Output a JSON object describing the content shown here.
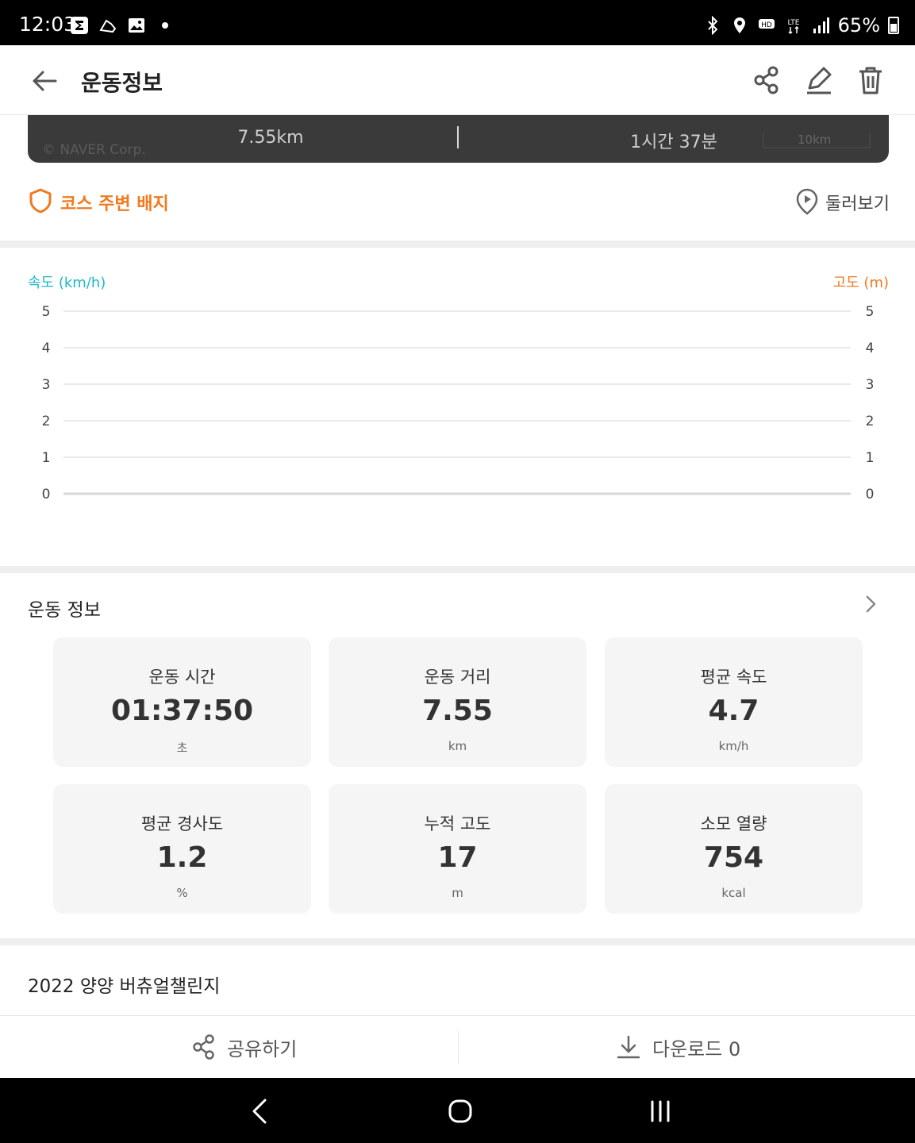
{
  "status_bar": {
    "time": "12:03",
    "battery": "65%"
  },
  "app_bar": {
    "title": "운동정보"
  },
  "map": {
    "credit": "© NAVER Corp.",
    "distance": "7.55km",
    "duration": "1시간 37분",
    "scale": "10km"
  },
  "badges": {
    "course_label": "코스 주변 배지",
    "tour_label": "둘러보기"
  },
  "chart_data": {
    "type": "line",
    "left_axis_label": "속도 (km/h)",
    "right_axis_label": "고도 (m)",
    "left_ticks": [
      "5",
      "4",
      "3",
      "2",
      "1",
      "0"
    ],
    "right_ticks": [
      "5",
      "4",
      "3",
      "2",
      "1",
      "0"
    ],
    "ylim": [
      0,
      5
    ],
    "grid": true,
    "series": [],
    "colors": {
      "speed": "#1fb7c6",
      "altitude": "#f07a1e"
    }
  },
  "workout": {
    "header": "운동 정보",
    "stats": [
      {
        "label": "운동 시간",
        "value": "01:37:50",
        "unit": "초"
      },
      {
        "label": "운동 거리",
        "value": "7.55",
        "unit": "km"
      },
      {
        "label": "평균 속도",
        "value": "4.7",
        "unit": "km/h"
      },
      {
        "label": "평균 경사도",
        "value": "1.2",
        "unit": "%"
      },
      {
        "label": "누적 고도",
        "value": "17",
        "unit": "m"
      },
      {
        "label": "소모 열량",
        "value": "754",
        "unit": "kcal"
      }
    ]
  },
  "challenge": {
    "title": "2022 양양 버츄얼챌린지"
  },
  "bottom_actions": {
    "share_label": "공유하기",
    "download_label": "다운로드 0"
  },
  "theme": {
    "accent_orange": "#f07a1e",
    "accent_teal": "#1fb7c6"
  }
}
